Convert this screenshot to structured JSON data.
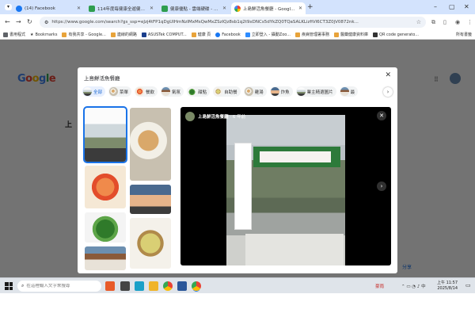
{
  "browser": {
    "tabs": [
      {
        "title": "(14) Facebook",
        "favicon": "facebook-icon"
      },
      {
        "title": "114年度每健康全遊健康學期...",
        "favicon": "green-doc-icon"
      },
      {
        "title": "健康優點 - 雲端硬碟 - 健康優點...",
        "favicon": "green-doc-icon"
      },
      {
        "title": "上島鮮活魚餐廳 - Google 搜尋",
        "favicon": "google-icon",
        "active": true
      }
    ],
    "url": "https://www.google.com/search?gs_ssp=eJzj4tFP1qDgUIHmNzIMxMsQwMxZSzIQz8sb1q2t9xDNCs5dYkZQ0TQaSALKLizfiVl6CT3Z0jV0872nk..."
  },
  "bookmarks": [
    "書用程式",
    "Bookmarks",
    "有我共享 - Google...",
    "連線的網路",
    "ASUSTek COMPUT...",
    "健康 頁",
    "Facebook",
    "立即登入 - 攝動Zoo...",
    "疾病管理署事務",
    "醫藥健康資料庫",
    "QR code generato..."
  ],
  "bookmarks_more": "所有書籤",
  "background_page": {
    "logo": [
      "G",
      "o",
      "o",
      "g",
      "l",
      "e"
    ],
    "title_fragment": "上",
    "share_label": "分享"
  },
  "modal": {
    "title": "上島鮮活魚餐廳",
    "chips": [
      {
        "label": "全部",
        "active": true
      },
      {
        "label": "菜單"
      },
      {
        "label": "餐飲"
      },
      {
        "label": "氣氛"
      },
      {
        "label": "甜點"
      },
      {
        "label": "自助餐"
      },
      {
        "label": "雞湯"
      },
      {
        "label": "炸魚"
      },
      {
        "label": "業主精選圖片"
      },
      {
        "label": "最"
      }
    ],
    "viewer": {
      "name": "上島鮮活魚餐廳",
      "subtitle": "· 6 年前"
    }
  },
  "taskbar": {
    "search_placeholder": "在這裡輸入文字來搜尋",
    "weather_text": "豪雨",
    "clock_time": "上午 11:57",
    "clock_date": "2025/8/14"
  }
}
